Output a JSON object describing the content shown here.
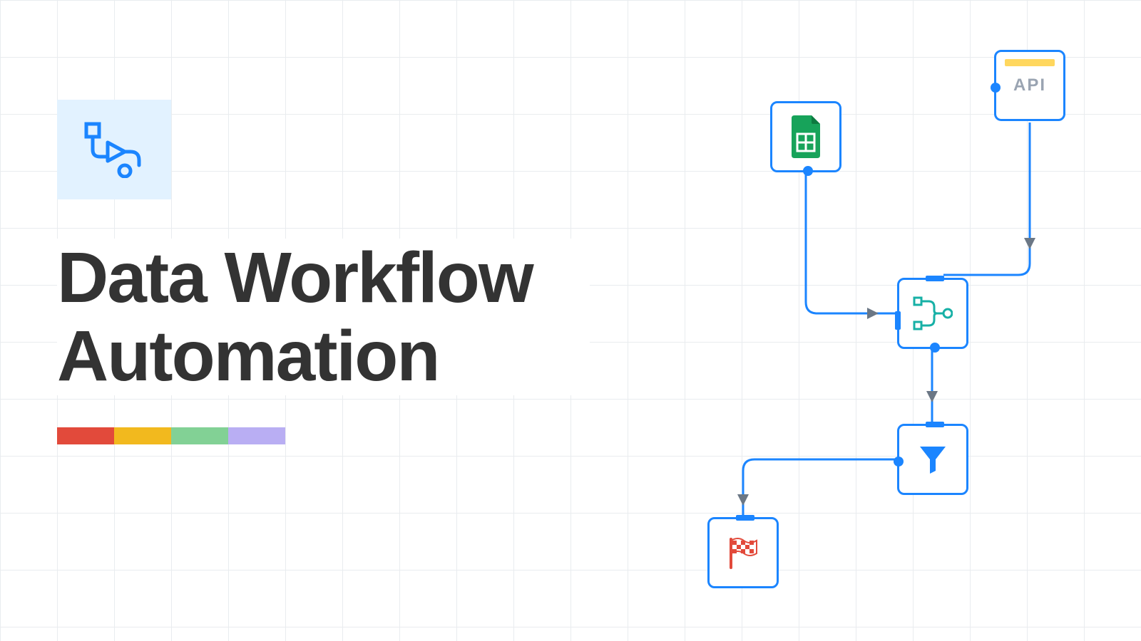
{
  "hero": {
    "title_line1": "Data Workflow",
    "title_line2": "Automation"
  },
  "color_bar": {
    "c1": "#e24a3b",
    "c2": "#f2b91e",
    "c3": "#82d195",
    "c4": "#b9aef3"
  },
  "nodes": {
    "api": {
      "label": "API"
    }
  }
}
